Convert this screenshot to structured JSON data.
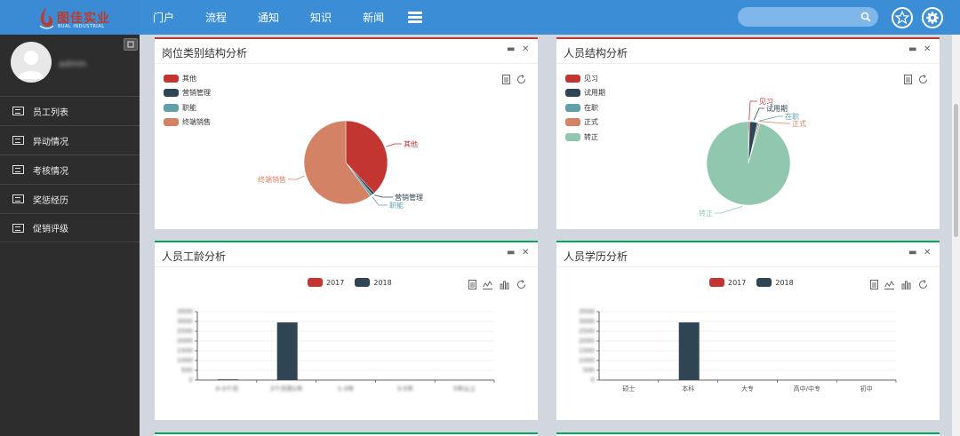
{
  "brand": {
    "name_cn": "图佳实业",
    "name_en": "BUAL INDUSTRIAL"
  },
  "nav": {
    "items": [
      "门户",
      "流程",
      "通知",
      "知识",
      "新闻"
    ]
  },
  "search": {
    "placeholder": ""
  },
  "user": {
    "name": "admin"
  },
  "sidebar": {
    "items": [
      {
        "label": "员工列表"
      },
      {
        "label": "异动情况"
      },
      {
        "label": "考核情况"
      },
      {
        "label": "奖惩经历"
      },
      {
        "label": "促销评级"
      }
    ]
  },
  "colors": {
    "red": "#c23531",
    "navy": "#2f4554",
    "teal": "#61a0a8",
    "orange": "#d48265",
    "mint": "#91c7ae"
  },
  "panels": {
    "post": {
      "title": "岗位类别结构分析",
      "legend": [
        "其他",
        "营销管理",
        "职能",
        "终端销售"
      ]
    },
    "staff": {
      "title": "人员结构分析",
      "legend": [
        "见习",
        "试用期",
        "在职",
        "正式",
        "转正"
      ]
    },
    "seniority": {
      "title": "人员工龄分析",
      "legend": [
        "2017",
        "2018"
      ]
    },
    "education": {
      "title": "人员学历分析",
      "legend": [
        "2017",
        "2018"
      ]
    }
  },
  "chart_data": [
    {
      "type": "pie",
      "title": "岗位类别结构分析",
      "categories": [
        "其他",
        "营销管理",
        "职能",
        "终端销售"
      ],
      "values": [
        38,
        1,
        1,
        60
      ]
    },
    {
      "type": "pie",
      "title": "人员结构分析",
      "categories": [
        "见习",
        "试用期",
        "在职",
        "正式",
        "转正"
      ],
      "values": [
        0.5,
        3,
        0.5,
        0.5,
        95.5
      ]
    },
    {
      "type": "bar",
      "title": "人员工龄分析",
      "categories": [
        "0-3个月",
        "3个月到1年",
        "1-3年",
        "3-5年",
        "5年以上"
      ],
      "series": [
        {
          "name": "2017",
          "values": [
            0,
            0,
            0,
            0,
            0
          ]
        },
        {
          "name": "2018",
          "values": [
            10,
            2950,
            0,
            0,
            0
          ]
        }
      ],
      "yticks": [
        "3500",
        "3000",
        "2500",
        "2000",
        "1500",
        "1000",
        "500",
        "0"
      ],
      "ylim": [
        0,
        3500
      ]
    },
    {
      "type": "bar",
      "title": "人员学历分析",
      "categories": [
        "硕士",
        "本科",
        "大专",
        "高中/中专",
        "初中"
      ],
      "series": [
        {
          "name": "2017",
          "values": [
            0,
            0,
            0,
            0,
            0
          ]
        },
        {
          "name": "2018",
          "values": [
            0,
            2950,
            0,
            0,
            0
          ]
        }
      ],
      "yticks": [
        "3500",
        "3000",
        "2500",
        "2000",
        "1500",
        "1000",
        "500",
        "0"
      ],
      "ylim": [
        0,
        3500
      ]
    }
  ]
}
